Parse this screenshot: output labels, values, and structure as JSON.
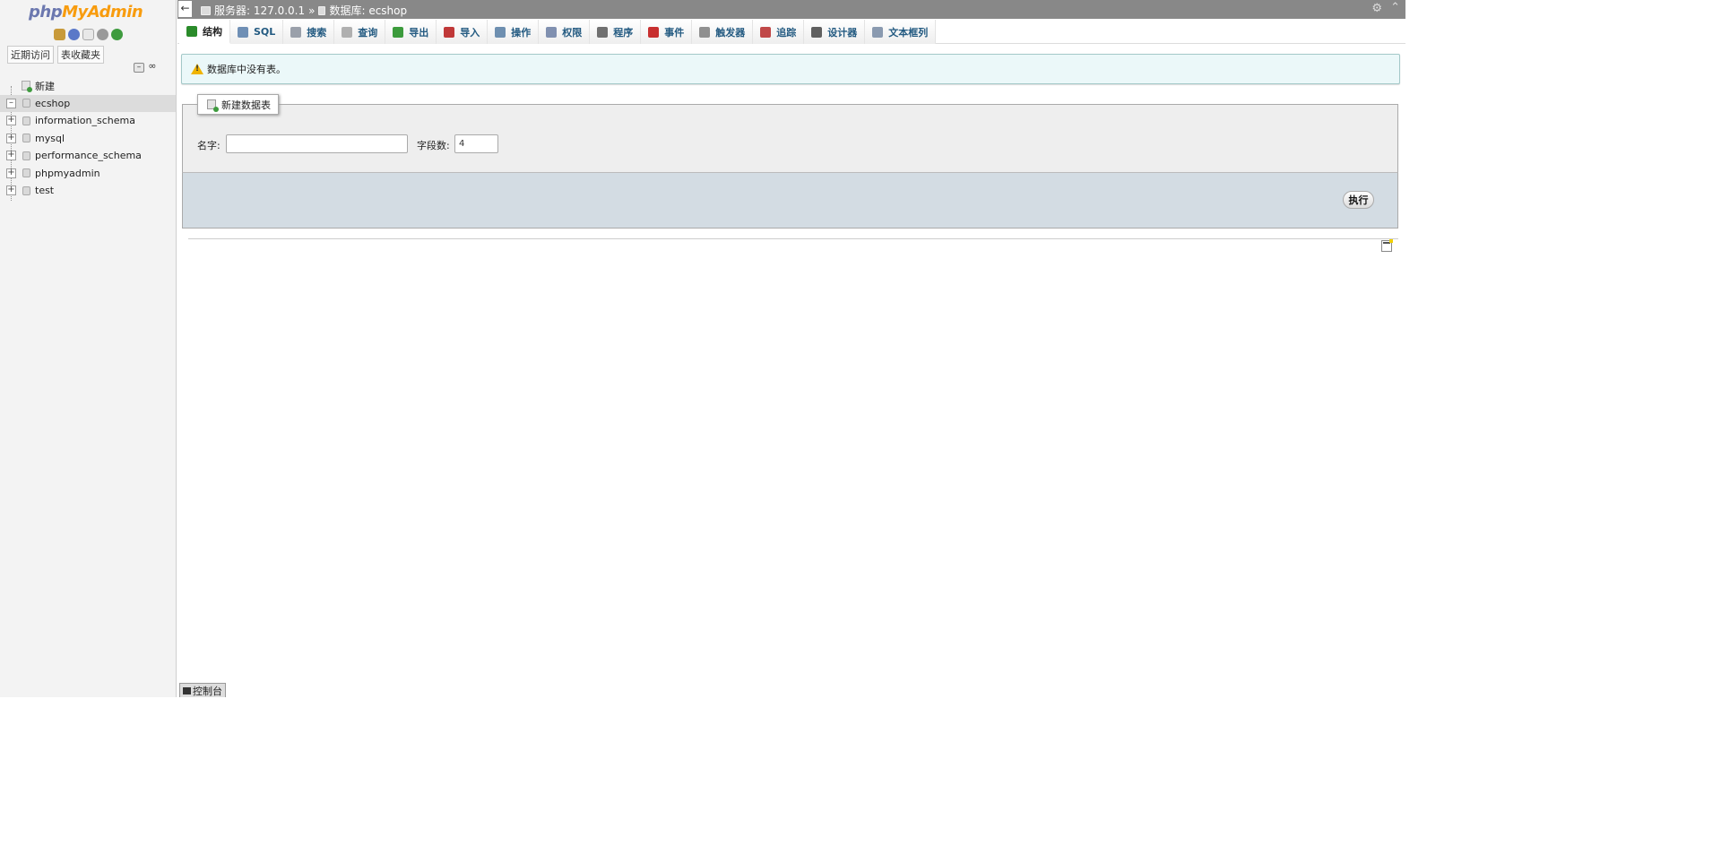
{
  "sidebar": {
    "logo_php": "php",
    "logo_myadmin": "MyAdmin",
    "quick_icons": [
      "home-icon",
      "help-icon",
      "docs-icon",
      "settings-icon",
      "reload-icon"
    ],
    "tabs": {
      "recent": "近期访问",
      "favorites": "表收藏夹"
    },
    "tree_tools": {
      "collapse_all": "–",
      "link_with_main": "∞"
    },
    "tree": [
      {
        "label": "新建",
        "type": "new"
      },
      {
        "label": "ecshop",
        "type": "db",
        "expander": "–",
        "active": true
      },
      {
        "label": "information_schema",
        "type": "db",
        "expander": "+"
      },
      {
        "label": "mysql",
        "type": "db",
        "expander": "+"
      },
      {
        "label": "performance_schema",
        "type": "db",
        "expander": "+"
      },
      {
        "label": "phpmyadmin",
        "type": "db",
        "expander": "+"
      },
      {
        "label": "test",
        "type": "db",
        "expander": "+"
      }
    ]
  },
  "topbar": {
    "back": "←",
    "server_label": "服务器: 127.0.0.1",
    "separator": "»",
    "db_label": "数据库: ecshop",
    "gear": "⚙",
    "collapse": "⌃"
  },
  "menu": {
    "tabs": [
      {
        "label": "结构",
        "icon": "structure-icon",
        "color": "#2a8b2a",
        "active": true
      },
      {
        "label": "SQL",
        "icon": "sql-icon",
        "color": "#6f8fb5"
      },
      {
        "label": "搜索",
        "icon": "search-icon",
        "color": "#9aa0aa"
      },
      {
        "label": "查询",
        "icon": "query-icon",
        "color": "#b0b0b0"
      },
      {
        "label": "导出",
        "icon": "export-icon",
        "color": "#3c9b3c"
      },
      {
        "label": "导入",
        "icon": "import-icon",
        "color": "#c03838"
      },
      {
        "label": "操作",
        "icon": "wrench-icon",
        "color": "#6e8fb0"
      },
      {
        "label": "权限",
        "icon": "privileges-icon",
        "color": "#8090b0"
      },
      {
        "label": "程序",
        "icon": "routines-icon",
        "color": "#707070"
      },
      {
        "label": "事件",
        "icon": "events-icon",
        "color": "#c83030"
      },
      {
        "label": "触发器",
        "icon": "triggers-icon",
        "color": "#909090"
      },
      {
        "label": "追踪",
        "icon": "eye-icon",
        "color": "#c04848"
      },
      {
        "label": "设计器",
        "icon": "designer-icon",
        "color": "#606060"
      },
      {
        "label": "文本框列",
        "icon": "columns-icon",
        "color": "#8a9ab0"
      }
    ]
  },
  "notice": {
    "message": "数据库中没有表。",
    "icon": "warning-icon"
  },
  "create_table": {
    "legend": "新建数据表",
    "name_label": "名字:",
    "name_value": "",
    "columns_label": "字段数:",
    "columns_value": "4",
    "go_label": "执行"
  },
  "console": {
    "label": "控制台"
  }
}
